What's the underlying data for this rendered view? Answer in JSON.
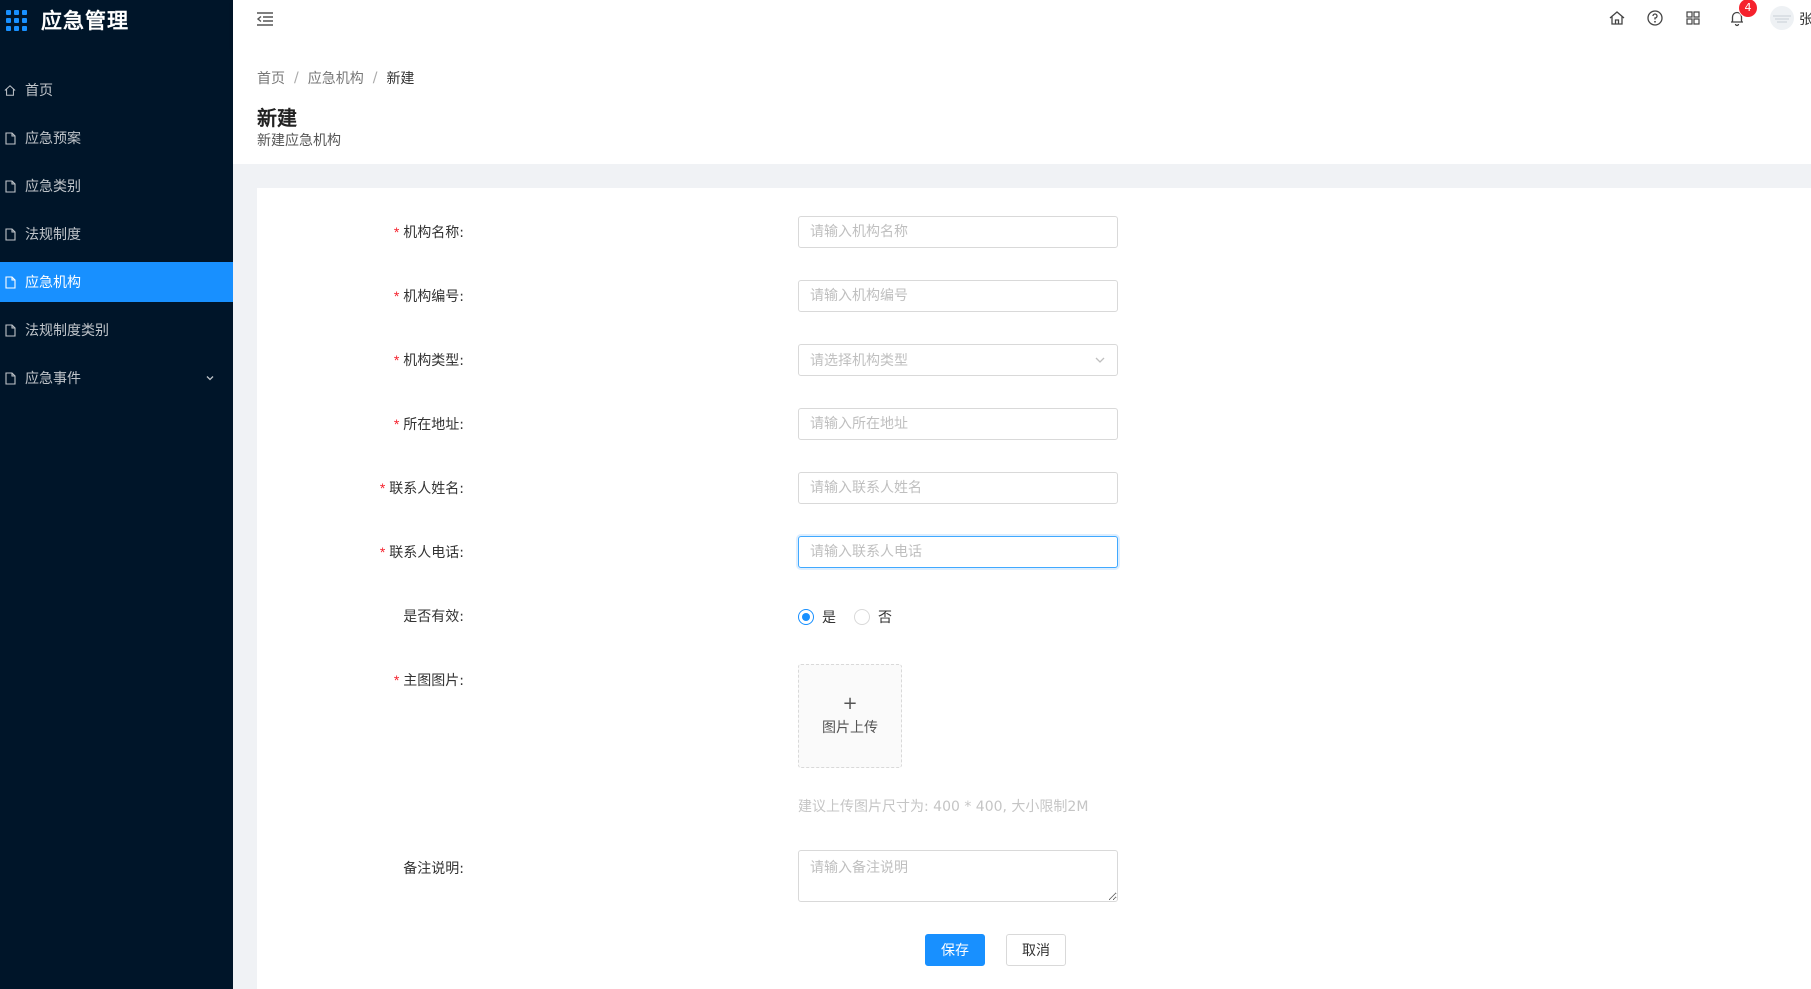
{
  "app": {
    "title": "应急管理"
  },
  "sidebar": {
    "items": [
      {
        "label": "首页",
        "icon": "home-icon"
      },
      {
        "label": "应急预案",
        "icon": "file-icon"
      },
      {
        "label": "应急类别",
        "icon": "file-icon"
      },
      {
        "label": "法规制度",
        "icon": "file-icon"
      },
      {
        "label": "应急机构",
        "icon": "file-icon",
        "active": true
      },
      {
        "label": "法规制度类别",
        "icon": "file-icon"
      },
      {
        "label": "应急事件",
        "icon": "file-icon",
        "expandable": true
      }
    ]
  },
  "header": {
    "icons": [
      "menu-fold-icon",
      "home-icon",
      "help-icon",
      "apps-icon",
      "bell-icon"
    ],
    "notification_count": "4",
    "user_name": "张"
  },
  "breadcrumb": {
    "items": [
      "首页",
      "应急机构",
      "新建"
    ]
  },
  "page": {
    "title": "新建",
    "subtitle": "新建应急机构"
  },
  "form": {
    "org_name": {
      "label": "机构名称",
      "placeholder": "请输入机构名称",
      "required": true
    },
    "org_code": {
      "label": "机构编号",
      "placeholder": "请输入机构编号",
      "required": true
    },
    "org_type": {
      "label": "机构类型",
      "placeholder": "请选择机构类型",
      "required": true
    },
    "address": {
      "label": "所在地址",
      "placeholder": "请输入所在地址",
      "required": true
    },
    "contact_name": {
      "label": "联系人姓名",
      "placeholder": "请输入联系人姓名",
      "required": true
    },
    "contact_phone": {
      "label": "联系人电话",
      "placeholder": "请输入联系人电话",
      "required": true
    },
    "is_valid": {
      "label": "是否有效",
      "options": [
        "是",
        "否"
      ],
      "selected": "是"
    },
    "main_image": {
      "label": "主图图片",
      "upload_text": "图片上传",
      "hint": "建议上传图片尺寸为: 400 * 400, 大小限制2M",
      "required": true
    },
    "remark": {
      "label": "备注说明",
      "placeholder": "请输入备注说明"
    },
    "save_label": "保存",
    "cancel_label": "取消"
  },
  "colors": {
    "sidebar_bg": "#001529",
    "primary": "#1890ff",
    "required": "#f5222d",
    "badge": "#f5222d"
  }
}
